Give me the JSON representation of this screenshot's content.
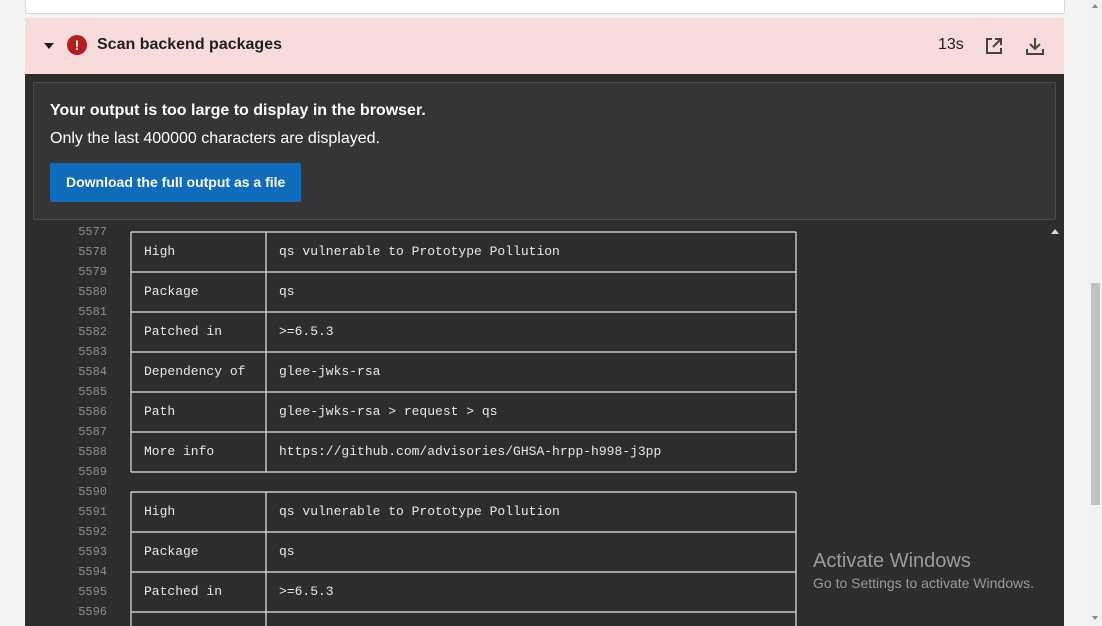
{
  "step": {
    "title": "Scan backend packages",
    "duration": "13s",
    "status_icon": "error-icon",
    "colors": {
      "header_bg": "#fadbdb",
      "error": "#b41e1e"
    }
  },
  "notice": {
    "title": "Your output is too large to display in the browser.",
    "body": "Only the last 400000 characters are displayed.",
    "download_label": "Download the full output as a file"
  },
  "log": {
    "rows": [
      {
        "num": "5577",
        "c1": "",
        "c2": ""
      },
      {
        "num": "5578",
        "c1": "High",
        "c2": "qs vulnerable to Prototype Pollution"
      },
      {
        "num": "5579",
        "c1": "",
        "c2": ""
      },
      {
        "num": "5580",
        "c1": "Package",
        "c2": "qs"
      },
      {
        "num": "5581",
        "c1": "",
        "c2": ""
      },
      {
        "num": "5582",
        "c1": "Patched in",
        "c2": ">=6.5.3"
      },
      {
        "num": "5583",
        "c1": "",
        "c2": ""
      },
      {
        "num": "5584",
        "c1": "Dependency of",
        "c2": "glee-jwks-rsa"
      },
      {
        "num": "5585",
        "c1": "",
        "c2": ""
      },
      {
        "num": "5586",
        "c1": "Path",
        "c2": "glee-jwks-rsa > request > qs"
      },
      {
        "num": "5587",
        "c1": "",
        "c2": ""
      },
      {
        "num": "5588",
        "c1": "More info",
        "c2": "https://github.com/advisories/GHSA-hrpp-h998-j3pp"
      },
      {
        "num": "5589",
        "c1": "",
        "c2": ""
      },
      {
        "num": "5590",
        "c1": "",
        "c2": ""
      },
      {
        "num": "5591",
        "c1": "High",
        "c2": "qs vulnerable to Prototype Pollution"
      },
      {
        "num": "5592",
        "c1": "",
        "c2": ""
      },
      {
        "num": "5593",
        "c1": "Package",
        "c2": "qs"
      },
      {
        "num": "5594",
        "c1": "",
        "c2": ""
      },
      {
        "num": "5595",
        "c1": "Patched in",
        "c2": ">=6.5.3"
      },
      {
        "num": "5596",
        "c1": "",
        "c2": ""
      }
    ]
  },
  "watermark": {
    "title": "Activate Windows",
    "subtitle": "Go to Settings to activate Windows."
  }
}
